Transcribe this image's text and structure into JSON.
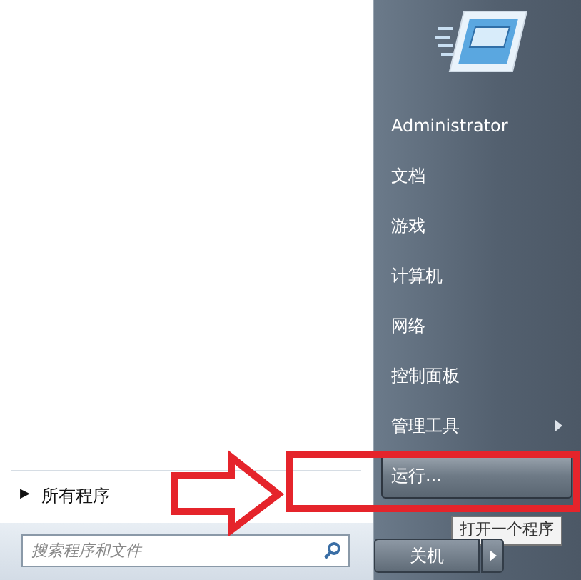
{
  "left_panel": {
    "all_programs": {
      "arrow": "▶",
      "label": "所有程序"
    },
    "search": {
      "placeholder": "搜索程序和文件"
    }
  },
  "right_panel": {
    "items": [
      {
        "label": "Administrator",
        "selected": false,
        "submenu": false
      },
      {
        "label": "文档",
        "selected": false,
        "submenu": false
      },
      {
        "label": "游戏",
        "selected": false,
        "submenu": false
      },
      {
        "label": "计算机",
        "selected": false,
        "submenu": false
      },
      {
        "label": "网络",
        "selected": false,
        "submenu": false
      },
      {
        "label": "控制面板",
        "selected": false,
        "submenu": false
      },
      {
        "label": "管理工具",
        "selected": false,
        "submenu": true
      },
      {
        "label": "运行...",
        "selected": true,
        "submenu": false
      }
    ],
    "tooltip": "打开一个程序",
    "shutdown": {
      "label": "关机"
    }
  }
}
